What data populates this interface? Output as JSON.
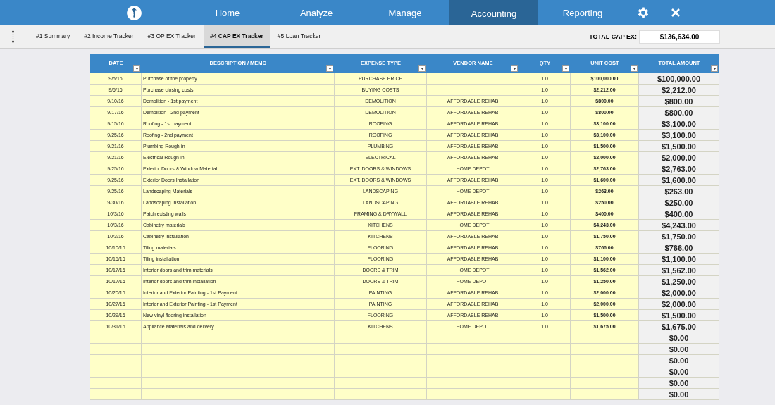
{
  "nav": {
    "items": [
      {
        "label": "Home",
        "selected": false
      },
      {
        "label": "Analyze",
        "selected": false
      },
      {
        "label": "Manage",
        "selected": false
      },
      {
        "label": "Accounting",
        "selected": true
      },
      {
        "label": "Reporting",
        "selected": false
      }
    ]
  },
  "sheet_tabs": [
    {
      "label": "#1 Summary",
      "selected": false
    },
    {
      "label": "#2 Income Tracker",
      "selected": false
    },
    {
      "label": "#3 OP EX Tracker",
      "selected": false
    },
    {
      "label": "#4 CAP EX Tracker",
      "selected": true
    },
    {
      "label": "#5 Loan Tracker",
      "selected": false
    }
  ],
  "total": {
    "label": "TOTAL CAP EX:",
    "value": "$136,634.00"
  },
  "table": {
    "columns": [
      "DATE",
      "DESCRIPTION / MEMO",
      "EXPENSE TYPE",
      "VENDOR NAME",
      "QTY",
      "UNIT COST",
      "TOTAL AMOUNT"
    ],
    "rows": [
      [
        "9/5/16",
        "Purchase of the property",
        "PURCHASE PRICE",
        "",
        "1.0",
        "$100,000.00",
        "$100,000.00"
      ],
      [
        "9/5/16",
        "Purchase closing costs",
        "BUYING COSTS",
        "",
        "1.0",
        "$2,212.00",
        "$2,212.00"
      ],
      [
        "9/10/16",
        "Demolition - 1st payment",
        "DEMOLITION",
        "AFFORDABLE REHAB",
        "1.0",
        "$800.00",
        "$800.00"
      ],
      [
        "9/17/16",
        "Demolition - 2nd payment",
        "DEMOLITION",
        "AFFORDABLE REHAB",
        "1.0",
        "$800.00",
        "$800.00"
      ],
      [
        "9/15/16",
        "Roofing - 1st payment",
        "ROOFING",
        "AFFORDABLE REHAB",
        "1.0",
        "$3,100.00",
        "$3,100.00"
      ],
      [
        "9/25/16",
        "Roofing - 2nd payment",
        "ROOFING",
        "AFFORDABLE REHAB",
        "1.0",
        "$3,100.00",
        "$3,100.00"
      ],
      [
        "9/21/16",
        "Plumbing Rough-in",
        "PLUMBING",
        "AFFORDABLE REHAB",
        "1.0",
        "$1,500.00",
        "$1,500.00"
      ],
      [
        "9/21/16",
        "Electrical Rough-in",
        "ELECTRICAL",
        "AFFORDABLE REHAB",
        "1.0",
        "$2,000.00",
        "$2,000.00"
      ],
      [
        "9/25/16",
        "Exterior Doors & Window Material",
        "EXT. DOORS & WINDOWS",
        "HOME DEPOT",
        "1.0",
        "$2,763.00",
        "$2,763.00"
      ],
      [
        "9/25/16",
        "Exterior Doors Installation",
        "EXT. DOORS & WINDOWS",
        "AFFORDABLE REHAB",
        "1.0",
        "$1,600.00",
        "$1,600.00"
      ],
      [
        "9/25/16",
        "Landscaping Materials",
        "LANDSCAPING",
        "HOME DEPOT",
        "1.0",
        "$263.00",
        "$263.00"
      ],
      [
        "9/30/16",
        "Landscaping Installation",
        "LANDSCAPING",
        "AFFORDABLE REHAB",
        "1.0",
        "$250.00",
        "$250.00"
      ],
      [
        "10/3/16",
        "Patch existing walls",
        "FRAMING & DRYWALL",
        "AFFORDABLE REHAB",
        "1.0",
        "$400.00",
        "$400.00"
      ],
      [
        "10/3/16",
        "Cabinetry materials",
        "KITCHENS",
        "HOME DEPOT",
        "1.0",
        "$4,243.00",
        "$4,243.00"
      ],
      [
        "10/3/16",
        "Cabinetry installation",
        "KITCHENS",
        "AFFORDABLE REHAB",
        "1.0",
        "$1,750.00",
        "$1,750.00"
      ],
      [
        "10/10/16",
        "Tiling materials",
        "FLOORING",
        "AFFORDABLE REHAB",
        "1.0",
        "$766.00",
        "$766.00"
      ],
      [
        "10/15/16",
        "Tiling installation",
        "FLOORING",
        "AFFORDABLE REHAB",
        "1.0",
        "$1,100.00",
        "$1,100.00"
      ],
      [
        "10/17/16",
        "Interior doors and trim materials",
        "DOORS & TRIM",
        "HOME DEPOT",
        "1.0",
        "$1,562.00",
        "$1,562.00"
      ],
      [
        "10/17/16",
        "Interior doors and trim installation",
        "DOORS & TRIM",
        "HOME DEPOT",
        "1.0",
        "$1,250.00",
        "$1,250.00"
      ],
      [
        "10/20/16",
        "Interior and Exterior Painting - 1st Payment",
        "PAINTING",
        "AFFORDABLE REHAB",
        "1.0",
        "$2,000.00",
        "$2,000.00"
      ],
      [
        "10/27/16",
        "Interior and Exterior Painting - 1st Payment",
        "PAINTING",
        "AFFORDABLE REHAB",
        "1.0",
        "$2,000.00",
        "$2,000.00"
      ],
      [
        "10/29/16",
        "New vinyl flooring installation",
        "FLOORING",
        "AFFORDABLE REHAB",
        "1.0",
        "$1,500.00",
        "$1,500.00"
      ],
      [
        "10/31/16",
        "Appliance Materials and delivery",
        "KITCHENS",
        "HOME DEPOT",
        "1.0",
        "$1,675.00",
        "$1,675.00"
      ],
      [
        "",
        "",
        "",
        "",
        "",
        "",
        "$0.00"
      ],
      [
        "",
        "",
        "",
        "",
        "",
        "",
        "$0.00"
      ],
      [
        "",
        "",
        "",
        "",
        "",
        "",
        "$0.00"
      ],
      [
        "",
        "",
        "",
        "",
        "",
        "",
        "$0.00"
      ],
      [
        "",
        "",
        "",
        "",
        "",
        "",
        "$0.00"
      ],
      [
        "",
        "",
        "",
        "",
        "",
        "",
        "$0.00"
      ]
    ]
  }
}
